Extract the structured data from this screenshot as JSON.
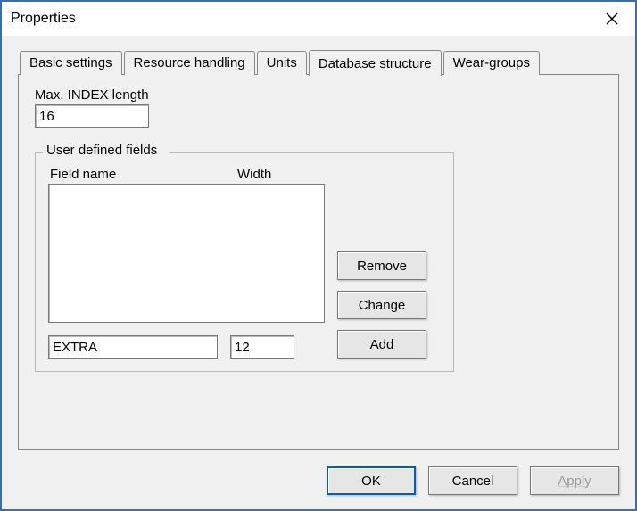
{
  "window": {
    "title": "Properties"
  },
  "tabs": [
    {
      "label": "Basic settings",
      "active": false
    },
    {
      "label": "Resource handling",
      "active": false
    },
    {
      "label": "Units",
      "active": false
    },
    {
      "label": "Database structure",
      "active": true
    },
    {
      "label": "Wear-groups",
      "active": false
    }
  ],
  "panel": {
    "maxIndexLabel": "Max. INDEX length",
    "maxIndexValue": "16",
    "group": {
      "title": "User defined fields",
      "headers": {
        "name": "Field name",
        "width": "Width"
      },
      "edit": {
        "name": "EXTRA",
        "width": "12"
      },
      "buttons": {
        "remove": "Remove",
        "change": "Change",
        "add": "Add"
      }
    }
  },
  "dialogButtons": {
    "ok": "OK",
    "cancel": "Cancel",
    "apply": "Apply"
  }
}
